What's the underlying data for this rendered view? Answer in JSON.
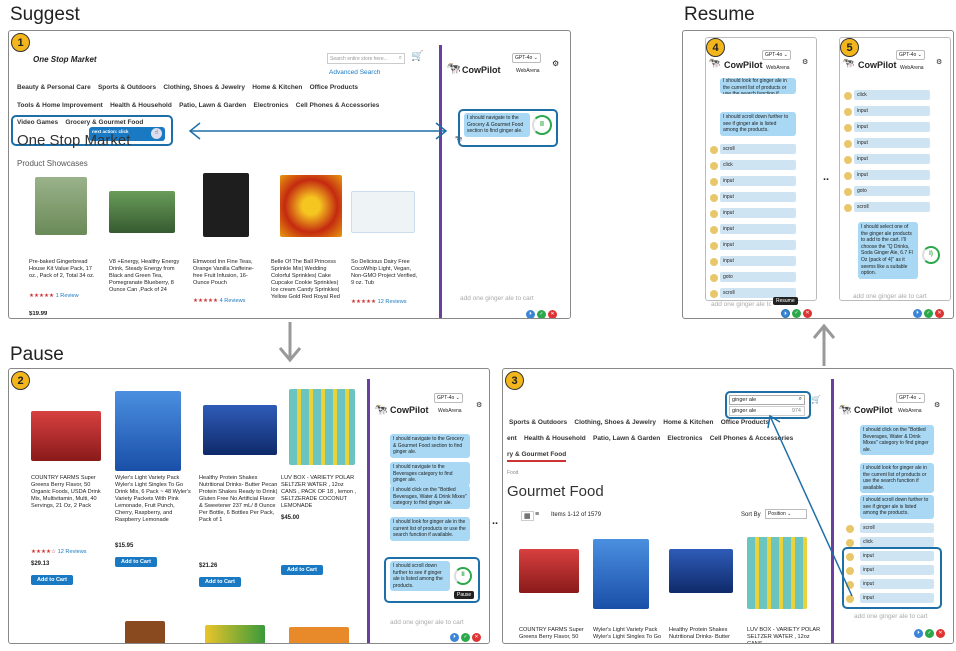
{
  "sections": {
    "suggest": "Suggest",
    "resume": "Resume",
    "pause": "Pause"
  },
  "steps": [
    "1",
    "2",
    "3",
    "4",
    "5"
  ],
  "copilot": {
    "name": "CowPilot",
    "model": "GPT-4o",
    "mode": "WebArena",
    "prompt": "add one ginger ale to cart"
  },
  "panel1": {
    "store": "One Stop Market",
    "search_placeholder": "Search entire store here...",
    "advanced": "Advanced Search",
    "nav1": [
      "Beauty & Personal Care",
      "Sports & Outdoors",
      "Clothing, Shoes & Jewelry",
      "Home & Kitchen",
      "Office Products"
    ],
    "nav2": [
      "Tools & Home Improvement",
      "Health & Household",
      "Patio, Lawn & Garden",
      "Electronics",
      "Cell Phones & Accessories"
    ],
    "nav3": [
      "Video Games",
      "Grocery & Gourmet Food"
    ],
    "tooltip": "next action: click",
    "heading": "One Stop Market",
    "showcase": "Product Showcases",
    "products": [
      {
        "name": "Pre-baked Gingerbread House Kit Value Pack, 17 oz., Pack of 2, Total 34 oz.",
        "reviews": "1 Review",
        "color": "#7a9a68"
      },
      {
        "name": "V8 +Energy, Healthy Energy Drink, Steady Energy from Black and Green Tea, Pomegranate Blueberry, 8 Ounce Can ,Pack of 24",
        "reviews": "",
        "color": "#5a8a4a"
      },
      {
        "name": "Elmwood Inn Fine Teas, Orange Vanilla Caffeine-free Fruit Infusion, 16-Ounce Pouch",
        "reviews": "4 Reviews",
        "color": "#1e1e1e"
      },
      {
        "name": "Belle Of The Ball Princess Sprinkle Mix| Wedding Colorful Sprinkles| Cake Cupcake Cookie Sprinkles| Ice cream Candy Sprinkles| Yellow Gold Red Royal Red Rose Icing Flowers Decorating Sprinkles, 8OZ",
        "reviews": "",
        "color": "#c42a10"
      },
      {
        "name": "So Delicious Dairy Free CocoWhip Light, Vegan, Non-GMO Project Verified, 9 oz. Tub",
        "reviews": "12 Reviews",
        "color": "#d8e6ee"
      }
    ],
    "price_partial": "$19.99",
    "bubble": "I should navigate to the Grocery & Gourmet Food section to find ginger ale."
  },
  "panel2": {
    "products": [
      {
        "name": "COUNTRY FARMS Super Greens Berry Flavor, 50 Organic Foods, USDA Drink Mix, Multivitamin, Multi, 40 Servings, 21 Oz, 2 Pack",
        "reviews": "12 Reviews",
        "price": "$29.13",
        "color": "#b92a2a"
      },
      {
        "name": "Wyler's Light Variety Pack Wyler's Light Singles To Go Drink Mix, 6 Pack ~ 48 Wyler's Variety Packets With Pink Lemonade, Fruit Punch, Cherry, Raspberry, and Raspberry Lemonade",
        "reviews": "",
        "price": "$15.95",
        "color": "#2f7bd0"
      },
      {
        "name": "Healthy Protein Shakes Nutritional Drinks- Butter Pecan Protein Shakes Ready to Drink| Gluten Free No Artificial Flavor & Sweetener 237 mL/ 8 Ounce Per Bottle, 6 Bottles Per Pack, Pack of 1",
        "reviews": "",
        "price": "$21.26",
        "color": "#1b3f8a"
      },
      {
        "name": "LUV BOX - VARIETY POLAR SELTZER WATER , 12oz CANS , PACK OF 18 , lemon , SELTZERADE COCONUT LEMONADE",
        "reviews": "",
        "price": "$45.00",
        "color": "#4aa3a0"
      }
    ],
    "add_to_cart": "Add to Cart",
    "bubbles": [
      "I should navigate to the Grocery & Gourmet Food section to find ginger ale.",
      "I should navigate to the Beverages category to find ginger ale.",
      "I should click on the \"Bottled Beverages, Water & Drink Mixes\" category to find ginger ale.",
      "I should look for ginger ale in the current list of products or use the search function if available.",
      "I should scroll down further to see if ginger ale is listed among the products."
    ],
    "pause_label": "Pause"
  },
  "panel3": {
    "search_value": "ginger ale",
    "suggestion": "ginger ale",
    "suggestion_count": "974",
    "nav1": [
      "Sports & Outdoors",
      "Clothing, Shoes & Jewelry",
      "Home & Kitchen",
      "Office Products"
    ],
    "nav2": [
      "ent",
      "Health & Household",
      "Patio, Lawn & Garden",
      "Electronics",
      "Cell Phones & Accessories"
    ],
    "nav3": "ry & Gourmet Food",
    "crumb": "Food",
    "heading": "Gourmet Food",
    "items": "Items 1-12 of 1579",
    "sortby": "Sort By",
    "sortval": "Position",
    "product_names": [
      "COUNTRY FARMS Super Greens Berry Flavor, 50",
      "Wyler's Light Variety Pack Wyler's Light Singles To Go",
      "Healthy Protein Shakes Nutritional Drinks- Butter",
      "LUV BOX - VARIETY POLAR SELTZER WATER , 12oz CANS"
    ],
    "bubbles": [
      "I should click on the \"Bottled Beverages, Water & Drink Mixes\" category to find ginger ale.",
      "I should look for ginger ale in the current list of products or use the search function if available.",
      "I should scroll down further to see if ginger ale is listed among the products."
    ],
    "actions": [
      "scroll",
      "click",
      "input",
      "input",
      "input",
      "input"
    ]
  },
  "panel4": {
    "bubbles": [
      "I should look for ginger ale in the current list of products or use the search function if available.",
      "I should scroll down further to see if ginger ale is listed among the products."
    ],
    "actions": [
      "scroll",
      "click",
      "input",
      "input",
      "input",
      "input",
      "input",
      "input",
      "goto",
      "scroll"
    ],
    "resume_label": "Resume"
  },
  "panel5": {
    "actions": [
      "click",
      "input",
      "input",
      "input",
      "input",
      "input",
      "goto",
      "scroll"
    ],
    "bubble": "I should select one of the ginger ale products to add to the cart. I'll choose the \"Q Drinks, Soda Ginger Ale, 6.7 Fl Oz (pack of 4)\" as it seems like a suitable option."
  },
  "ellipsis": ".."
}
